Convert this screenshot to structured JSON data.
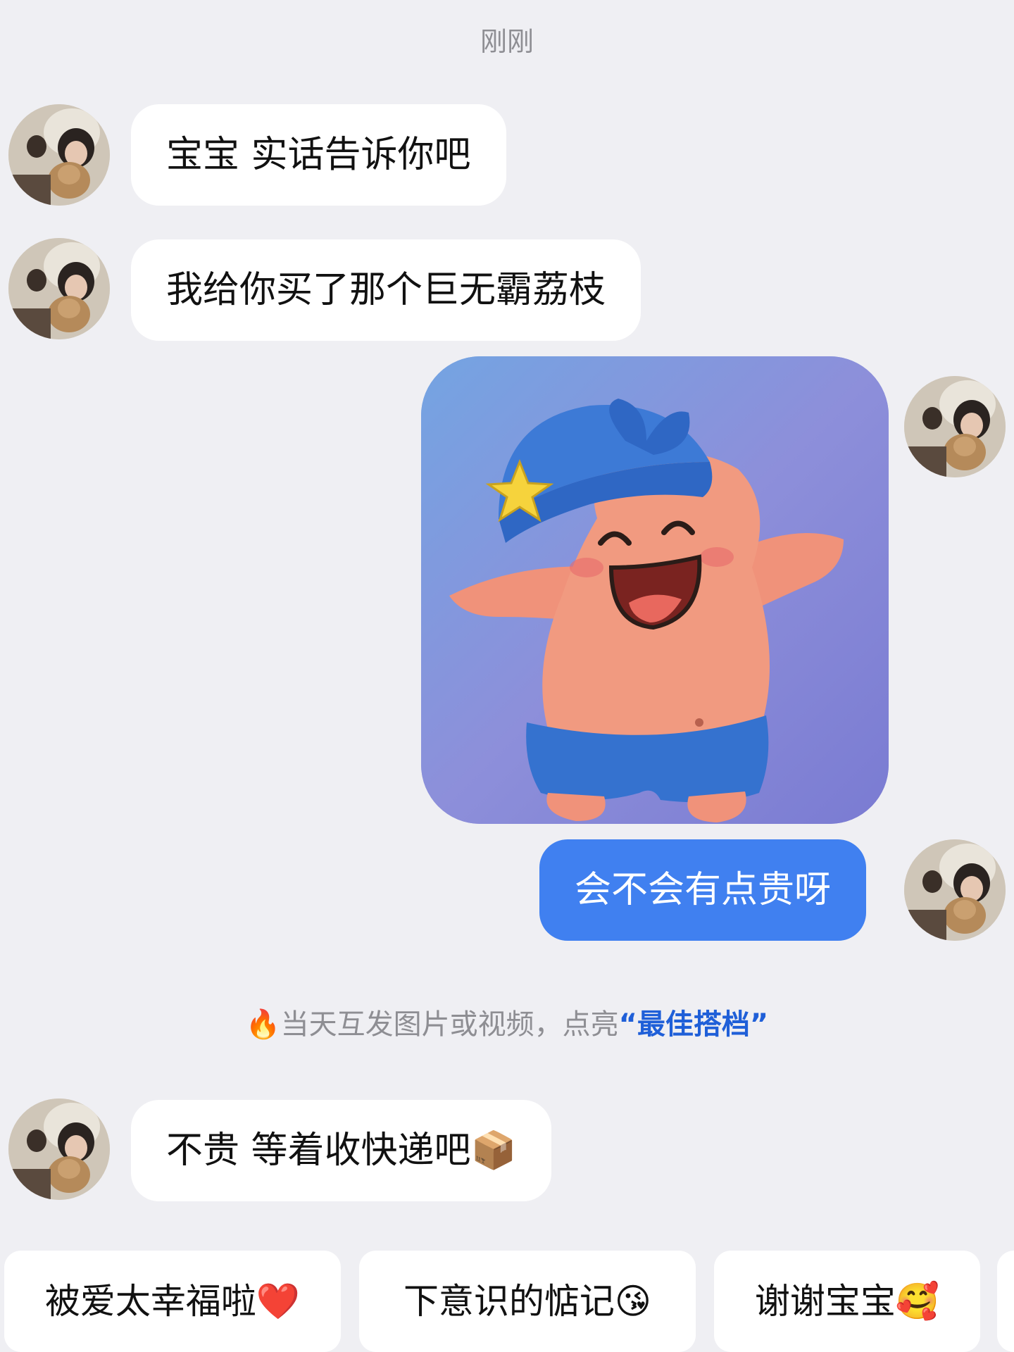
{
  "timestamp": "刚刚",
  "messages": [
    {
      "side": "left",
      "text": "宝宝 实话告诉你吧"
    },
    {
      "side": "left",
      "text": "我给你买了那个巨无霸荔枝"
    },
    {
      "side": "right",
      "type": "image",
      "alt": ""
    },
    {
      "side": "right",
      "text": "会不会有点贵呀"
    },
    {
      "side": "left",
      "text": "不贵 等着收快递吧📦"
    }
  ],
  "system_tip": {
    "icon": "🔥",
    "prefix": "当天互发图片或视频，点亮",
    "highlight": "“最佳搭档”"
  },
  "suggestions": [
    {
      "label": "被爱太幸福啦❤️"
    },
    {
      "label": "下意识的惦记😘"
    },
    {
      "label": "谢谢宝宝🥰"
    }
  ],
  "colors": {
    "background": "#efeff3",
    "sent_bubble": "#4080f0",
    "received_bubble": "#ffffff",
    "tip_highlight": "#1f5fd8"
  }
}
